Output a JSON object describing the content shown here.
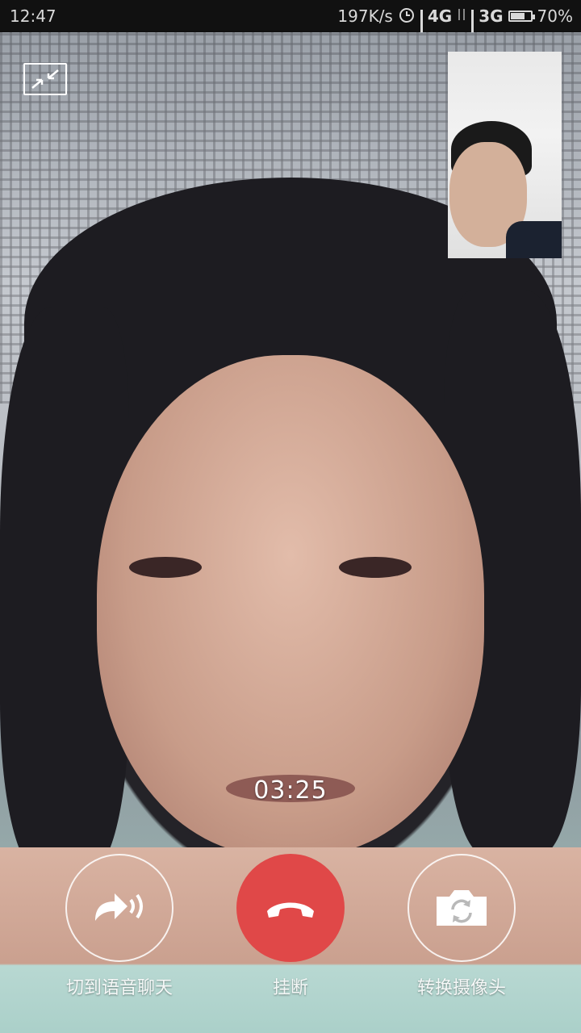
{
  "status_bar": {
    "time": "12:47",
    "net_speed": "197K/s",
    "network_1": "4G",
    "network_2": "3G",
    "battery_percent": "70%",
    "battery_level": 0.7
  },
  "call": {
    "timer": "03:25"
  },
  "controls": {
    "voice_label": "切到语音聊天",
    "hangup_label": "挂断",
    "camera_label": "转换摄像头"
  },
  "colors": {
    "hangup": "#e04848",
    "status_bar_bg": "#111111"
  },
  "icons": {
    "minimize": "minimize-arrows-icon",
    "voice": "switch-to-voice-icon",
    "hangup": "phone-hangup-icon",
    "camera": "switch-camera-icon"
  }
}
